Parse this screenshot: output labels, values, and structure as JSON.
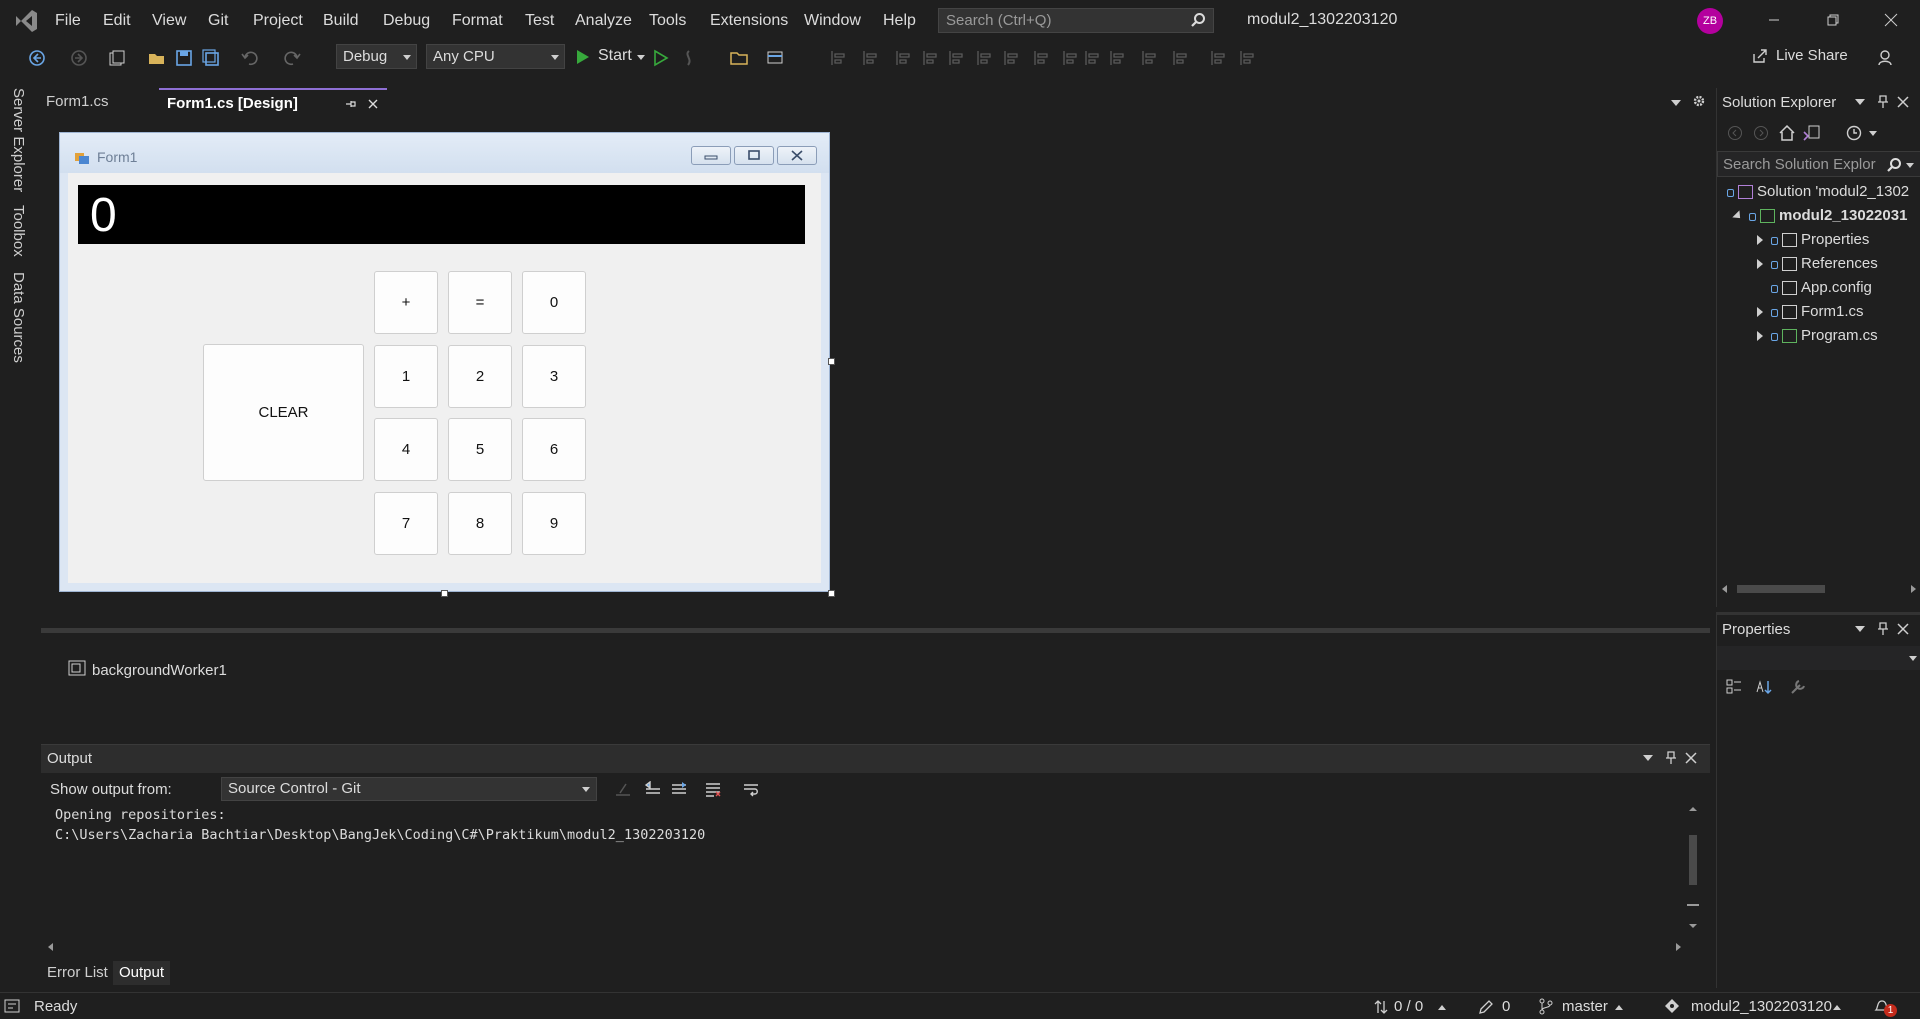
{
  "menu": {
    "items": [
      "File",
      "Edit",
      "View",
      "Git",
      "Project",
      "Build",
      "Debug",
      "Format",
      "Test",
      "Analyze",
      "Tools",
      "Extensions",
      "Window",
      "Help"
    ],
    "search_placeholder": "Search (Ctrl+Q)",
    "solution_title": "modul2_1302203120",
    "avatar_initials": "ZB"
  },
  "toolbar": {
    "config": "Debug",
    "platform": "Any CPU",
    "start_label": "Start",
    "live_share_label": "Live Share"
  },
  "side_tabs": [
    "Server Explorer",
    "Toolbox",
    "Data Sources"
  ],
  "doc_tabs": [
    {
      "label": "Form1.cs",
      "active": false
    },
    {
      "label": "Form1.cs [Design]",
      "active": true
    }
  ],
  "form": {
    "title": "Form1",
    "display_value": "0",
    "buttons": [
      "+",
      "=",
      "0",
      "1",
      "2",
      "3",
      "4",
      "5",
      "6",
      "7",
      "8",
      "9"
    ],
    "clear_label": "CLEAR"
  },
  "tray": {
    "component": "backgroundWorker1"
  },
  "output": {
    "title": "Output",
    "show_from_label": "Show output from:",
    "source": "Source Control - Git",
    "lines": [
      "Opening repositories:",
      "C:\\Users\\Zacharia Bachtiar\\Desktop\\BangJek\\Coding\\C#\\Praktikum\\modul2_1302203120"
    ]
  },
  "bottom_tabs": [
    {
      "label": "Error List",
      "active": false
    },
    {
      "label": "Output",
      "active": true
    }
  ],
  "solution_explorer": {
    "title": "Solution Explorer",
    "search_placeholder": "Search Solution Explor",
    "tree": [
      {
        "label": "Solution 'modul2_1302",
        "indent": 0,
        "expander": "none",
        "bold": false
      },
      {
        "label": "modul2_13022031",
        "indent": 1,
        "expander": "open",
        "bold": true
      },
      {
        "label": "Properties",
        "indent": 2,
        "expander": "closed",
        "bold": false
      },
      {
        "label": "References",
        "indent": 2,
        "expander": "closed",
        "bold": false
      },
      {
        "label": "App.config",
        "indent": 2,
        "expander": "none",
        "bold": false
      },
      {
        "label": "Form1.cs",
        "indent": 2,
        "expander": "closed",
        "bold": false
      },
      {
        "label": "Program.cs",
        "indent": 2,
        "expander": "closed",
        "bold": false
      }
    ]
  },
  "properties": {
    "title": "Properties"
  },
  "status": {
    "ready": "Ready",
    "line_count": "0 / 0",
    "pending_changes": "0",
    "branch": "master",
    "repo": "modul2_1302203120",
    "notifications": "1"
  },
  "colors": {
    "accent": "#8e6fd4",
    "avatar": "#b4009e",
    "start_green": "#37a93c"
  }
}
